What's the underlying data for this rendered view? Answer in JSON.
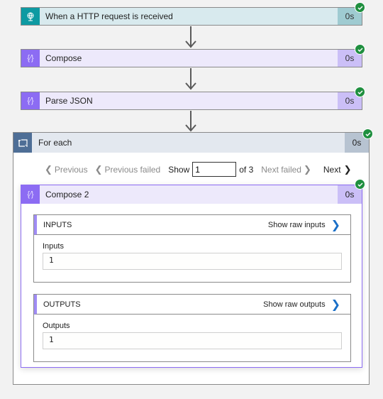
{
  "steps": [
    {
      "title": "When a HTTP request is received",
      "duration": "0s",
      "icon": "globe-request-icon",
      "status": "succeeded"
    },
    {
      "title": "Compose",
      "duration": "0s",
      "icon": "braces-icon",
      "status": "succeeded"
    },
    {
      "title": "Parse JSON",
      "duration": "0s",
      "icon": "braces-icon",
      "status": "succeeded"
    }
  ],
  "foreach": {
    "title": "For each",
    "duration": "0s",
    "icon": "loop-icon",
    "status": "succeeded",
    "pager": {
      "previous": "Previous",
      "previous_failed": "Previous failed",
      "show_label": "Show",
      "current": "1",
      "of_label": "of 3",
      "next_failed": "Next failed",
      "next": "Next"
    },
    "inner": {
      "title": "Compose 2",
      "duration": "0s",
      "icon": "braces-icon",
      "status": "succeeded",
      "inputs": {
        "heading": "INPUTS",
        "raw_link": "Show raw inputs",
        "label": "Inputs",
        "value": "1"
      },
      "outputs": {
        "heading": "OUTPUTS",
        "raw_link": "Show raw outputs",
        "label": "Outputs",
        "value": "1"
      }
    }
  },
  "colors": {
    "http_accent": "#0e9aa2",
    "compose_accent": "#8c6cf3",
    "foreach_accent": "#4e6e96",
    "success": "#1f8f3f",
    "link": "#1a6fc7"
  }
}
